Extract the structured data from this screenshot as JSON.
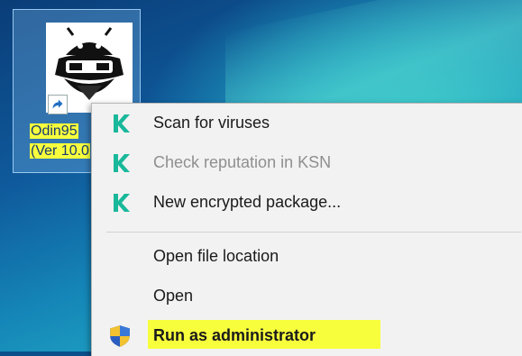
{
  "desktop_icon": {
    "label_line1": "Odin95",
    "label_line2": "(Ver 10.0"
  },
  "context_menu": {
    "items": [
      {
        "label": "Scan for viruses",
        "icon": "kaspersky-k-icon",
        "enabled": true
      },
      {
        "label": "Check reputation in KSN",
        "icon": "kaspersky-k-icon",
        "enabled": false
      },
      {
        "label": "New encrypted package...",
        "icon": "kaspersky-k-icon",
        "enabled": true
      },
      {
        "label": "Open file location",
        "enabled": true
      },
      {
        "label": "Open",
        "enabled": true
      },
      {
        "label": "Run as administrator",
        "icon": "uac-shield-icon",
        "enabled": true,
        "highlighted": true
      }
    ]
  },
  "colors": {
    "kaspersky_green": "#19b89a",
    "highlight_yellow": "#f7ff3c",
    "menu_background": "#f2f2f2",
    "disabled_text": "#8f8f8f"
  }
}
